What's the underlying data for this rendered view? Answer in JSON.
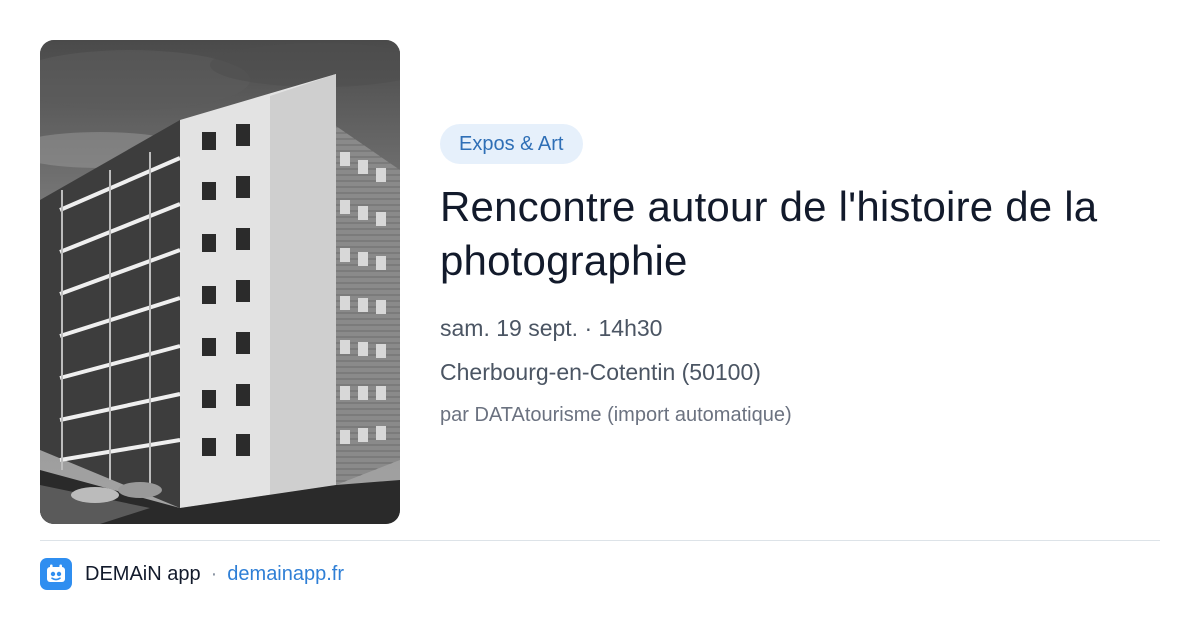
{
  "event": {
    "category": "Expos & Art",
    "title": "Rencontre autour de l'histoire de la photographie",
    "datetime": "sam. 19 sept. · 14h30",
    "location": "Cherbourg-en-Cotentin (50100)",
    "source": "par DATAtourisme (import automatique)"
  },
  "image": {
    "subject": "black-and-white photo of an apartment building"
  },
  "footer": {
    "app_name": "DEMAiN app",
    "separator": "·",
    "domain": "demainapp.fr"
  },
  "colors": {
    "accent": "#2f7fd6",
    "tag_bg": "#e6f0fb",
    "title": "#121a2b",
    "logo_bg": "#2f8ef0"
  }
}
